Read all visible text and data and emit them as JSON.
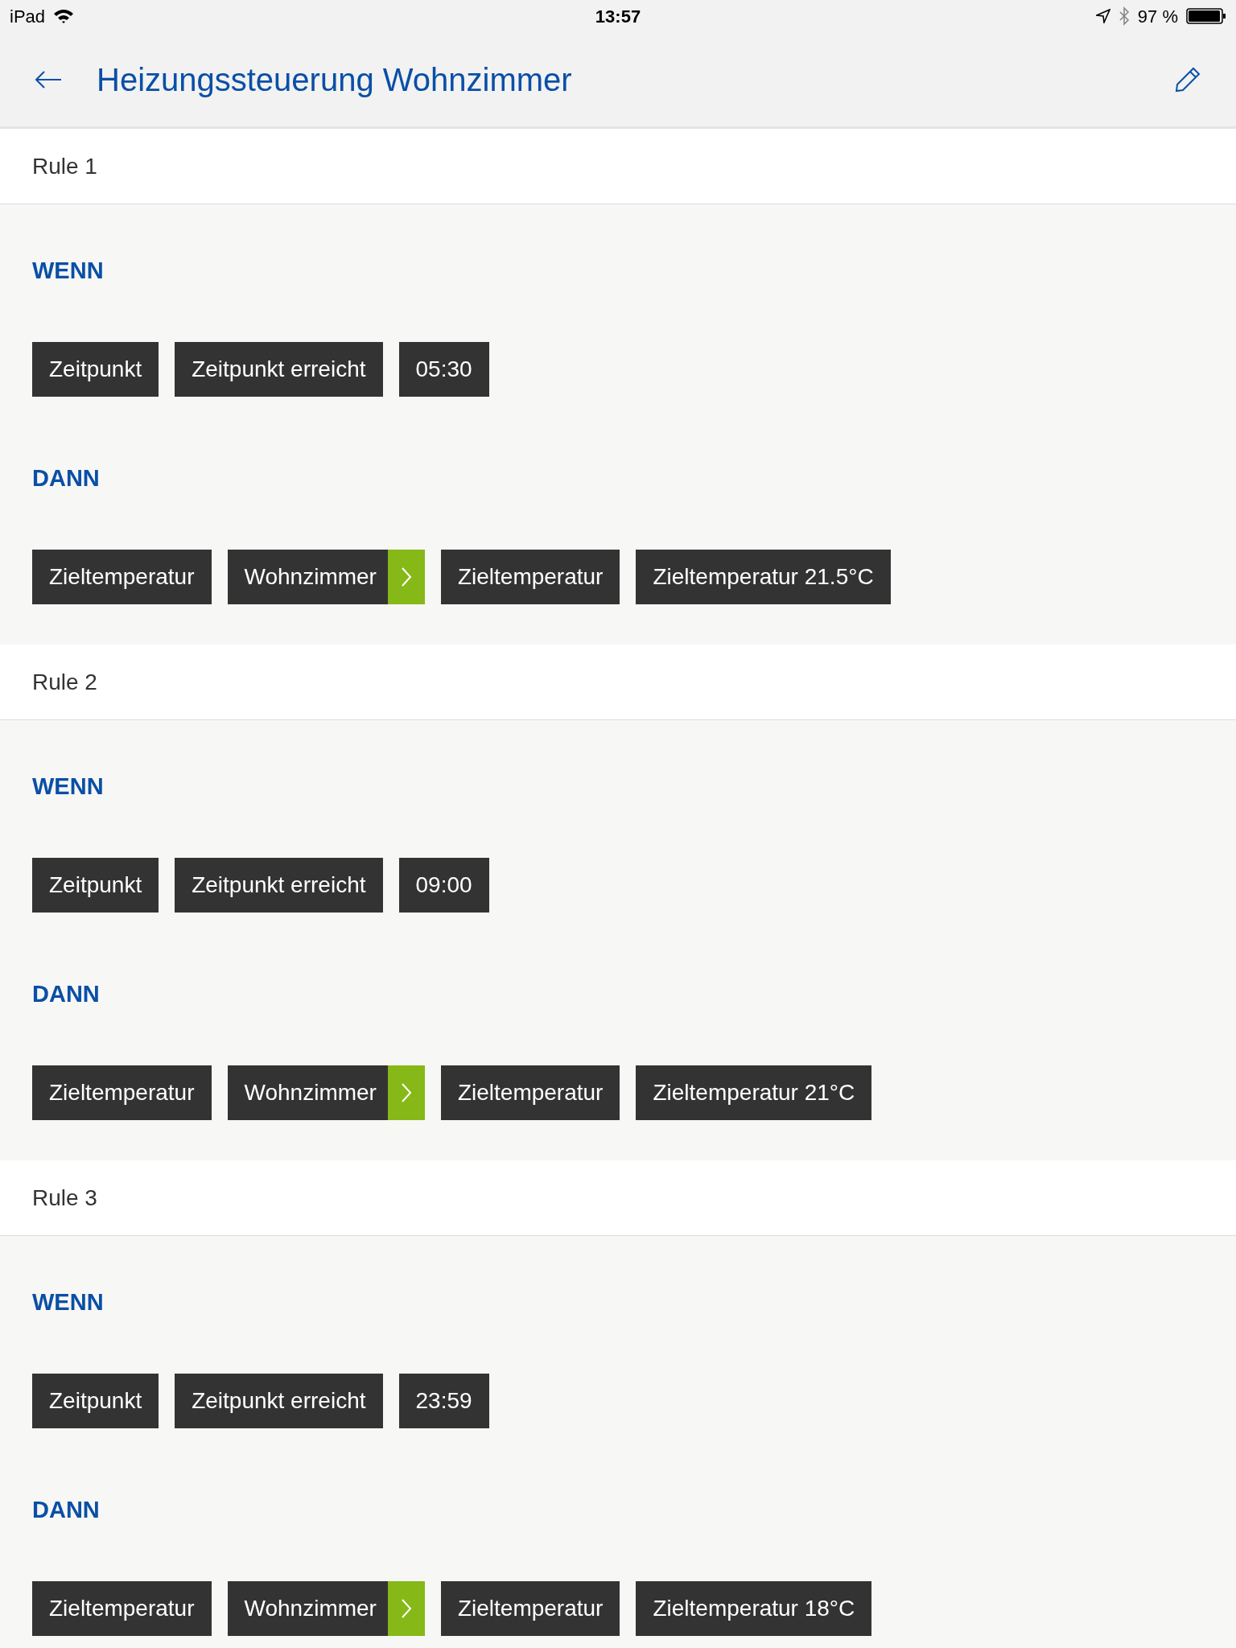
{
  "status_bar": {
    "device": "iPad",
    "time": "13:57",
    "battery": "97 %"
  },
  "header": {
    "title": "Heizungssteuerung Wohnzimmer"
  },
  "rules": [
    {
      "name": "Rule 1",
      "when": {
        "label": "WENN",
        "chips": [
          {
            "kind": "plain",
            "text": "Zeitpunkt"
          },
          {
            "kind": "plain",
            "text": "Zeitpunkt erreicht"
          },
          {
            "kind": "plain",
            "text": "05:30"
          }
        ]
      },
      "then": {
        "label": "DANN",
        "chips": [
          {
            "kind": "plain",
            "text": "Zieltemperatur"
          },
          {
            "kind": "link",
            "text": "Wohnzimmer"
          },
          {
            "kind": "plain",
            "text": "Zieltemperatur"
          },
          {
            "kind": "plain",
            "text": "Zieltemperatur 21.5°C"
          }
        ]
      }
    },
    {
      "name": "Rule 2",
      "when": {
        "label": "WENN",
        "chips": [
          {
            "kind": "plain",
            "text": "Zeitpunkt"
          },
          {
            "kind": "plain",
            "text": "Zeitpunkt erreicht"
          },
          {
            "kind": "plain",
            "text": "09:00"
          }
        ]
      },
      "then": {
        "label": "DANN",
        "chips": [
          {
            "kind": "plain",
            "text": "Zieltemperatur"
          },
          {
            "kind": "link",
            "text": "Wohnzimmer"
          },
          {
            "kind": "plain",
            "text": "Zieltemperatur"
          },
          {
            "kind": "plain",
            "text": "Zieltemperatur 21°C"
          }
        ]
      }
    },
    {
      "name": "Rule 3",
      "when": {
        "label": "WENN",
        "chips": [
          {
            "kind": "plain",
            "text": "Zeitpunkt"
          },
          {
            "kind": "plain",
            "text": "Zeitpunkt erreicht"
          },
          {
            "kind": "plain",
            "text": "23:59"
          }
        ]
      },
      "then": {
        "label": "DANN",
        "chips": [
          {
            "kind": "plain",
            "text": "Zieltemperatur"
          },
          {
            "kind": "link",
            "text": "Wohnzimmer"
          },
          {
            "kind": "plain",
            "text": "Zieltemperatur"
          },
          {
            "kind": "plain",
            "text": "Zieltemperatur 18°C"
          }
        ]
      }
    }
  ]
}
